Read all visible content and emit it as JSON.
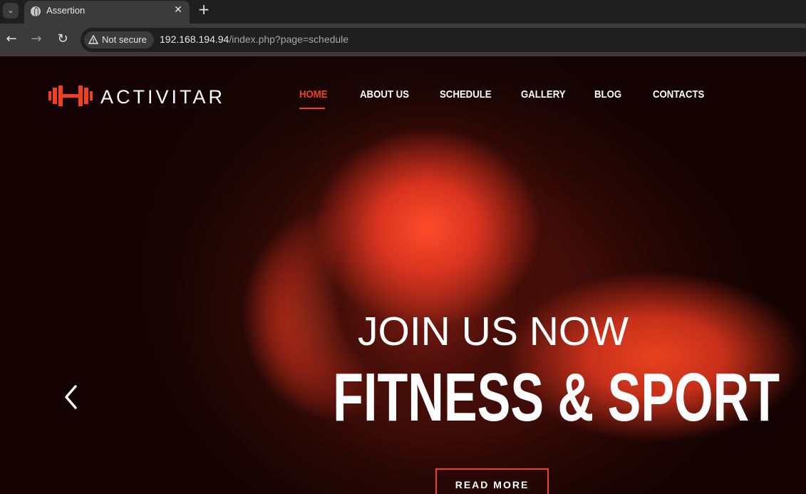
{
  "browser": {
    "tab_title": "Assertion",
    "tab_close_icon": "close-icon",
    "new_tab_label": "+",
    "security_label": "Not secure",
    "url_host": "192.168.194.94",
    "url_rest": "/index.php?page=schedule"
  },
  "site": {
    "logo_text": "ACTIVITAR",
    "nav": [
      {
        "label": "HOME",
        "active": true
      },
      {
        "label": "ABOUT US",
        "active": false
      },
      {
        "label": "SCHEDULE",
        "active": false
      },
      {
        "label": "GALLERY",
        "active": false
      },
      {
        "label": "BLOG",
        "active": false
      },
      {
        "label": "CONTACTS",
        "active": false
      }
    ],
    "hero": {
      "kicker": "JOIN US NOW",
      "headline": "FITNESS & SPORT",
      "cta": "READ MORE"
    }
  },
  "colors": {
    "accent": "#ef4122",
    "tab_bar": "#1f1f1f",
    "toolbar": "#3b3b3b"
  }
}
